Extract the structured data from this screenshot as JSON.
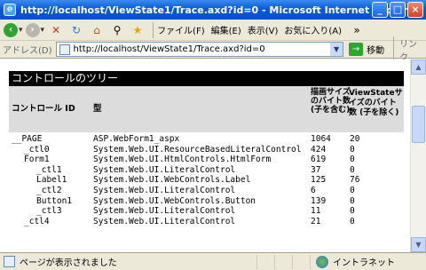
{
  "window": {
    "title": "http://localhost/ViewState1/Trace.axd?id=0 - Microsoft Internet Explorer",
    "minimize": "_",
    "maximize": "□",
    "close": "×"
  },
  "toolbar": {
    "file": "ファイル(F)",
    "edit": "編集(E)",
    "view": "表示(V)",
    "favorites": "お気に入り(A)",
    "back_glyph": "‹",
    "forward_glyph": "›"
  },
  "address": {
    "label": "アドレス(D)",
    "url": "http://localhost/ViewState1/Trace.axd?id=0",
    "go": "移動",
    "links": "リンク"
  },
  "section": {
    "title": "コントロールのツリー"
  },
  "columns": {
    "control_id": "コントロール ID",
    "type": "型",
    "render_size": "描画サイズのバイト数 (子を含む)",
    "viewstate_size": "ViewStateサイズのバイト数 (子を除く)"
  },
  "rows": [
    {
      "id": "__PAGE",
      "type": "ASP.WebForm1_aspx",
      "render": "1064",
      "viewstate": "20"
    },
    {
      "id": "_ctl0",
      "type": "System.Web.UI.ResourceBasedLiteralControl",
      "render": "424",
      "viewstate": "0"
    },
    {
      "id": "Form1",
      "type": "System.Web.UI.HtmlControls.HtmlForm",
      "render": "619",
      "viewstate": "0"
    },
    {
      "id": "_ctl1",
      "type": "System.Web.UI.LiteralControl",
      "render": "37",
      "viewstate": "0"
    },
    {
      "id": "Label1",
      "type": "System.Web.UI.WebControls.Label",
      "render": "125",
      "viewstate": "76"
    },
    {
      "id": "_ctl2",
      "type": "System.Web.UI.LiteralControl",
      "render": "6",
      "viewstate": "0"
    },
    {
      "id": "Button1",
      "type": "System.Web.UI.WebControls.Button",
      "render": "139",
      "viewstate": "0"
    },
    {
      "id": "_ctl3",
      "type": "System.Web.UI.LiteralControl",
      "render": "11",
      "viewstate": "0"
    },
    {
      "id": "_ctl4",
      "type": "System.Web.UI.LiteralControl",
      "render": "21",
      "viewstate": "0"
    }
  ],
  "status": {
    "text": "ページが表示されました",
    "zone": "イントラネット"
  }
}
